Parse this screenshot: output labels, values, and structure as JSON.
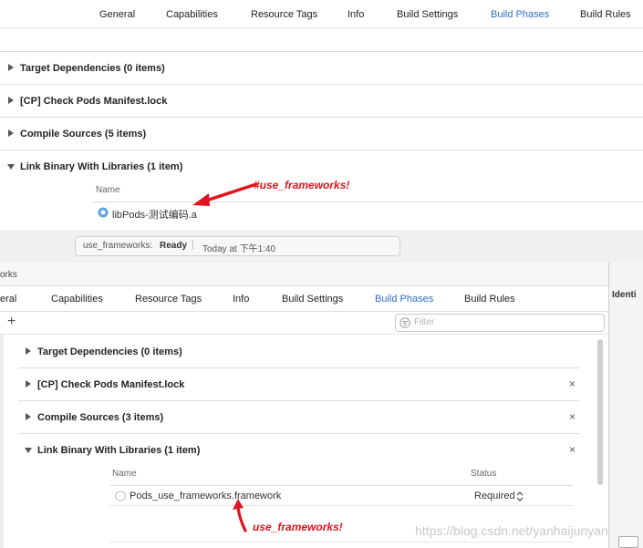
{
  "top": {
    "tabs": [
      "General",
      "Capabilities",
      "Resource Tags",
      "Info",
      "Build Settings",
      "Build Phases",
      "Build Rules"
    ],
    "active_tab": "Build Phases",
    "phases": [
      "Target Dependencies (0 items)",
      "[CP] Check Pods Manifest.lock",
      "Compile Sources (5 items)",
      "Link Binary With Libraries (1 item)"
    ],
    "col_name": "Name",
    "lib_file": "libPods-测试编码.a",
    "annotation": "#use_frameworks!"
  },
  "status": {
    "project": "use_frameworks: ",
    "state": "Ready",
    "separator": "|",
    "time": "Today at 下午1:40"
  },
  "bottom": {
    "works_label": "orks",
    "identity_label": "Identi",
    "tabs": [
      "eral",
      "Capabilities",
      "Resource Tags",
      "Info",
      "Build Settings",
      "Build Phases",
      "Build Rules"
    ],
    "active_tab": "Build Phases",
    "add_symbol": "+",
    "filter_placeholder": "Filter",
    "phases": [
      "Target Dependencies (0 items)",
      "[CP] Check Pods Manifest.lock",
      "Compile Sources (3 items)",
      "Link Binary With Libraries (1 item)"
    ],
    "close_symbol": "×",
    "col_name": "Name",
    "col_status": "Status",
    "framework_file": "Pods_use_frameworks.framework",
    "framework_status": "Required",
    "annotation": "use_frameworks!"
  },
  "watermark": "https://blog.csdn.net/yanhaijunyan",
  "colors": {
    "accent": "#2f6fc9",
    "annotation": "#e0141e"
  }
}
